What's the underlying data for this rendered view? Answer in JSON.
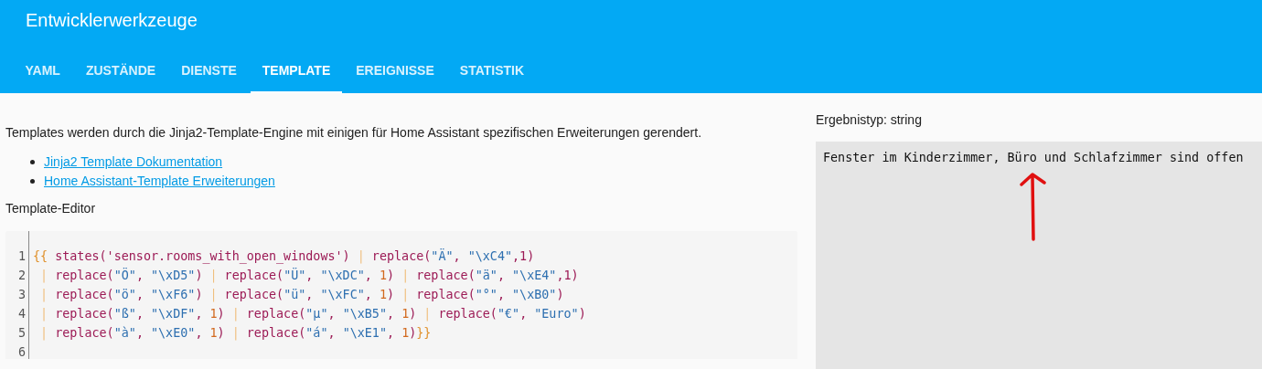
{
  "header": {
    "title": "Entwicklerwerkzeuge"
  },
  "tabs": [
    {
      "label": "YAML",
      "selected": false
    },
    {
      "label": "ZUSTÄNDE",
      "selected": false
    },
    {
      "label": "DIENSTE",
      "selected": false
    },
    {
      "label": "TEMPLATE",
      "selected": true
    },
    {
      "label": "EREIGNISSE",
      "selected": false
    },
    {
      "label": "STATISTIK",
      "selected": false
    }
  ],
  "intro": "Templates werden durch die Jinja2-Template-Engine mit einigen für Home Assistant spezifischen Erweiterungen gerendert.",
  "links": [
    "Jinja2 Template Dokumentation",
    "Home Assistant-Template Erweiterungen"
  ],
  "editor": {
    "label": "Template-Editor",
    "lines": [
      {
        "number": "1",
        "tokens": [
          {
            "text": "{{",
            "kind": "brace"
          },
          {
            "text": " states('sensor.rooms_with_open_windows') ",
            "kind": "func"
          },
          {
            "text": "|",
            "kind": "pipe"
          },
          {
            "text": " replace(",
            "kind": "func"
          },
          {
            "text": "\"Ä\"",
            "kind": "string"
          },
          {
            "text": ", ",
            "kind": "func"
          },
          {
            "text": "\"\\xC4\"",
            "kind": "string"
          },
          {
            "text": ",1)",
            "kind": "func"
          }
        ]
      },
      {
        "number": "2",
        "tokens": [
          {
            "text": " |",
            "kind": "pipe"
          },
          {
            "text": " replace(",
            "kind": "func"
          },
          {
            "text": "\"Ö\"",
            "kind": "string"
          },
          {
            "text": ", ",
            "kind": "func"
          },
          {
            "text": "\"\\xD5\"",
            "kind": "string"
          },
          {
            "text": ") ",
            "kind": "func"
          },
          {
            "text": "|",
            "kind": "pipe"
          },
          {
            "text": " replace(",
            "kind": "func"
          },
          {
            "text": "\"Ü\"",
            "kind": "string"
          },
          {
            "text": ", ",
            "kind": "func"
          },
          {
            "text": "\"\\xDC\"",
            "kind": "string"
          },
          {
            "text": ", ",
            "kind": "func"
          },
          {
            "text": "1",
            "kind": "number"
          },
          {
            "text": ") ",
            "kind": "func"
          },
          {
            "text": "|",
            "kind": "pipe"
          },
          {
            "text": " replace(",
            "kind": "func"
          },
          {
            "text": "\"ä\"",
            "kind": "string"
          },
          {
            "text": ", ",
            "kind": "func"
          },
          {
            "text": "\"\\xE4\"",
            "kind": "string"
          },
          {
            "text": ",1)",
            "kind": "func"
          }
        ]
      },
      {
        "number": "3",
        "tokens": [
          {
            "text": " |",
            "kind": "pipe"
          },
          {
            "text": " replace(",
            "kind": "func"
          },
          {
            "text": "\"ö\"",
            "kind": "string"
          },
          {
            "text": ", ",
            "kind": "func"
          },
          {
            "text": "\"\\xF6\"",
            "kind": "string"
          },
          {
            "text": ") ",
            "kind": "func"
          },
          {
            "text": "|",
            "kind": "pipe"
          },
          {
            "text": " replace(",
            "kind": "func"
          },
          {
            "text": "\"ü\"",
            "kind": "string"
          },
          {
            "text": ", ",
            "kind": "func"
          },
          {
            "text": "\"\\xFC\"",
            "kind": "string"
          },
          {
            "text": ", ",
            "kind": "func"
          },
          {
            "text": "1",
            "kind": "number"
          },
          {
            "text": ") ",
            "kind": "func"
          },
          {
            "text": "|",
            "kind": "pipe"
          },
          {
            "text": " replace(",
            "kind": "func"
          },
          {
            "text": "\"°\"",
            "kind": "string"
          },
          {
            "text": ", ",
            "kind": "func"
          },
          {
            "text": "\"\\xB0\"",
            "kind": "string"
          },
          {
            "text": ")",
            "kind": "func"
          }
        ]
      },
      {
        "number": "4",
        "tokens": [
          {
            "text": " |",
            "kind": "pipe"
          },
          {
            "text": " replace(",
            "kind": "func"
          },
          {
            "text": "\"ß\"",
            "kind": "string"
          },
          {
            "text": ", ",
            "kind": "func"
          },
          {
            "text": "\"\\xDF\"",
            "kind": "string"
          },
          {
            "text": ", ",
            "kind": "func"
          },
          {
            "text": "1",
            "kind": "number"
          },
          {
            "text": ") ",
            "kind": "func"
          },
          {
            "text": "|",
            "kind": "pipe"
          },
          {
            "text": " replace(",
            "kind": "func"
          },
          {
            "text": "\"µ\"",
            "kind": "string"
          },
          {
            "text": ", ",
            "kind": "func"
          },
          {
            "text": "\"\\xB5\"",
            "kind": "string"
          },
          {
            "text": ", ",
            "kind": "func"
          },
          {
            "text": "1",
            "kind": "number"
          },
          {
            "text": ") ",
            "kind": "func"
          },
          {
            "text": "|",
            "kind": "pipe"
          },
          {
            "text": " replace(",
            "kind": "func"
          },
          {
            "text": "\"€\"",
            "kind": "string"
          },
          {
            "text": ", ",
            "kind": "func"
          },
          {
            "text": "\"Euro\"",
            "kind": "string"
          },
          {
            "text": ")",
            "kind": "func"
          }
        ]
      },
      {
        "number": "5",
        "tokens": [
          {
            "text": " |",
            "kind": "pipe"
          },
          {
            "text": " replace(",
            "kind": "func"
          },
          {
            "text": "\"à\"",
            "kind": "string"
          },
          {
            "text": ", ",
            "kind": "func"
          },
          {
            "text": "\"\\xE0\"",
            "kind": "string"
          },
          {
            "text": ", ",
            "kind": "func"
          },
          {
            "text": "1",
            "kind": "number"
          },
          {
            "text": ") ",
            "kind": "func"
          },
          {
            "text": "|",
            "kind": "pipe"
          },
          {
            "text": " replace(",
            "kind": "func"
          },
          {
            "text": "\"á\"",
            "kind": "string"
          },
          {
            "text": ", ",
            "kind": "func"
          },
          {
            "text": "\"\\xE1\"",
            "kind": "string"
          },
          {
            "text": ", ",
            "kind": "func"
          },
          {
            "text": "1",
            "kind": "number"
          },
          {
            "text": ")",
            "kind": "func"
          },
          {
            "text": "}}",
            "kind": "brace"
          }
        ]
      },
      {
        "number": "6"
      }
    ]
  },
  "result": {
    "type_label": "Ergebnistyp: string",
    "output": "Fenster im Kinderzimmer, Büro und Schlafzimmer sind offen"
  }
}
